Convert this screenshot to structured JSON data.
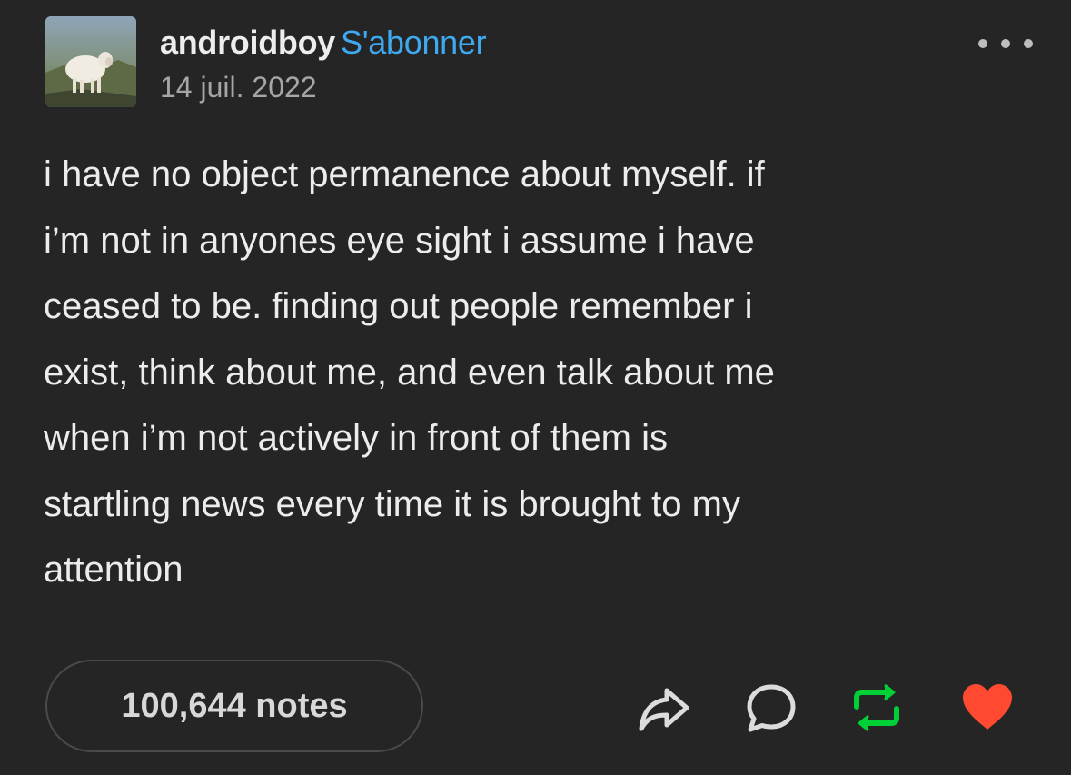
{
  "post": {
    "username": "androidboy",
    "follow_label": "S'abonner",
    "date": "14 juil. 2022",
    "body_lines": [
      "i have no object permanence about myself. if",
      "i’m not in anyones eye sight i assume i have",
      "ceased to be. finding out people remember i",
      "exist, think about me, and even talk about me",
      "when i’m not actively in front of them is",
      "startling news every time it is brought to my",
      "attention"
    ]
  },
  "footer": {
    "notes_label": "100,644 notes",
    "actions": [
      "share-icon",
      "reply-icon",
      "reblog-icon",
      "like-icon"
    ]
  },
  "colors": {
    "background": "#252525",
    "follow": "#3fa9f0",
    "reblog": "#00cf35",
    "like": "#ff4930"
  }
}
